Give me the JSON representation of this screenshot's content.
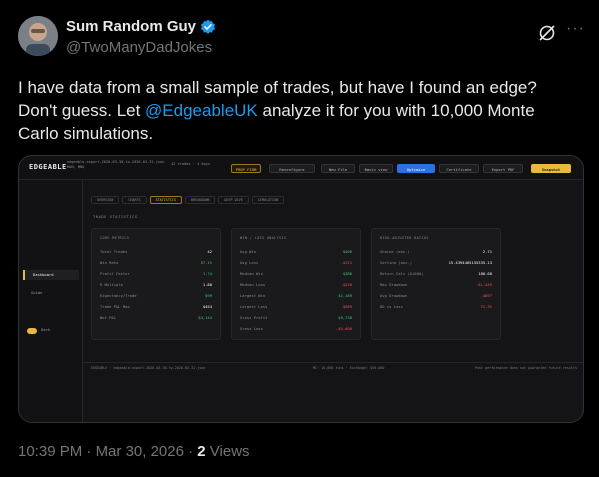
{
  "author": {
    "display_name": "Sum Random Guy",
    "handle": "@TwoManyDadJokes",
    "verified_color": "#1d9bf0"
  },
  "icons": {
    "verified": "verified-badge-icon",
    "grok": "grok-icon",
    "more": "more-options-icon"
  },
  "more_label": "···",
  "tweet": {
    "text_before": "I have data from a small sample of trades, but have I found an edge? Don't guess. Let ",
    "mention": "@EdgeableUK",
    "text_after": " analyze it for you with 10,000 Monte Carlo simulations."
  },
  "app": {
    "logo": "EDGEABLE",
    "file_info": "edgeable-export-2026-03-30-to-2026-03-31.json\nMAN, MNQ",
    "trade_count": "42 trades · 4 days",
    "toolbar": {
      "prop_firm": "PROP FIRM",
      "reconfigure": "Reconfigure",
      "new_file": "New File",
      "basic_view": "Basic view",
      "optimize": "Optimize",
      "certificate": "Certificate",
      "export_pdf": "Export PDF",
      "snapshot": "Snapshot"
    },
    "sidebar": {
      "dashboard": "Dashboard",
      "guide": "Guide",
      "dark_mode": "Dark"
    },
    "tabs": [
      "OVERVIEW",
      "CHARTS",
      "STATISTICS",
      "BREAKDOWN",
      "DEEP DIVE",
      "SIMULATION"
    ],
    "active_tab_index": 2,
    "section_title": "TRADE STATISTICS",
    "panels": [
      {
        "title": "CORE METRICS",
        "rows": [
          {
            "k": "Total Trades",
            "v": "42"
          },
          {
            "k": "Win Rate",
            "v": "57.1%"
          },
          {
            "k": "Profit Factor",
            "v": "1.74"
          },
          {
            "k": "R Multiple",
            "v": "1.80"
          },
          {
            "k": "Expectancy/Trade",
            "v": "$99"
          },
          {
            "k": "Trade P&L Max",
            "v": "$454"
          },
          {
            "k": "Net P&L",
            "v": "$4,143"
          }
        ]
      },
      {
        "title": "WIN / LOSS ANALYSIS",
        "rows": [
          {
            "k": "Avg Win",
            "v": "$406"
          },
          {
            "k": "Avg Loss",
            "v": "-$311"
          },
          {
            "k": "Median Win",
            "v": "$386"
          },
          {
            "k": "Median Loss",
            "v": "-$226"
          },
          {
            "k": "Largest Win",
            "v": "$1,189"
          },
          {
            "k": "Largest Loss",
            "v": "-$989"
          },
          {
            "k": "Gross Profit",
            "v": "$9,738"
          },
          {
            "k": "Gross Loss",
            "v": "-$5,600"
          }
        ]
      },
      {
        "title": "RISK-ADJUSTED RATIOS",
        "rows": [
          {
            "k": "Sharpe (ann.)",
            "v": "2.71"
          },
          {
            "k": "Sortino (ann.)",
            "v": "15.4394465155335.13"
          },
          {
            "k": "Return Calc ($1000)",
            "v": "180.60"
          },
          {
            "k": "Max Drawdown",
            "v": "-$1,445"
          },
          {
            "k": "Avg Drawdown",
            "v": "-$897"
          },
          {
            "k": "DD vs Loss",
            "v": "72.3%"
          }
        ]
      }
    ],
    "footer": {
      "left": "EDGEABLE · edgeable-export-2026-03-30-to-2026-03-31.json",
      "mid": "MC: 10,000 runs · Exchange: $50,000",
      "right": "Past performance does not guarantee future results"
    }
  },
  "meta": {
    "time": "10:39 PM",
    "sep": " · ",
    "date": "Mar 30, 2026",
    "views_count": "2",
    "views_label": " Views"
  }
}
